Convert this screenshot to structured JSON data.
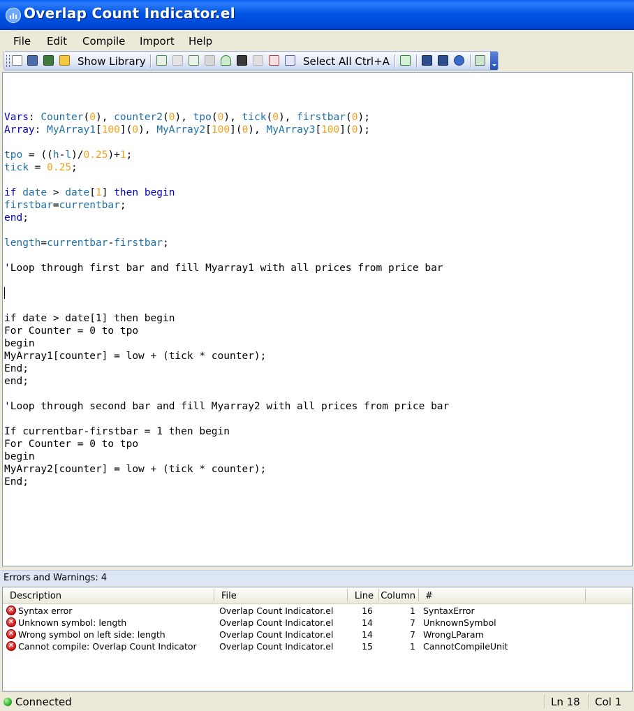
{
  "window": {
    "title": "Overlap Count Indicator.el"
  },
  "menu": {
    "items": [
      "File",
      "Edit",
      "Compile",
      "Import",
      "Help"
    ]
  },
  "toolbar": {
    "show_library_label": "Show Library",
    "select_all_label": "Select All Ctrl+A"
  },
  "editor": {
    "lines": [
      [
        [
          "Vars",
          1
        ],
        [
          ": ",
          0
        ],
        [
          "Counter",
          2
        ],
        [
          "(",
          0
        ],
        [
          "0",
          3
        ],
        [
          "), ",
          0
        ],
        [
          "counter2",
          2
        ],
        [
          "(",
          0
        ],
        [
          "0",
          3
        ],
        [
          "), ",
          0
        ],
        [
          "tpo",
          2
        ],
        [
          "(",
          0
        ],
        [
          "0",
          3
        ],
        [
          "), ",
          0
        ],
        [
          "tick",
          2
        ],
        [
          "(",
          0
        ],
        [
          "0",
          3
        ],
        [
          "), ",
          0
        ],
        [
          "firstbar",
          2
        ],
        [
          "(",
          0
        ],
        [
          "0",
          3
        ],
        [
          ");",
          0
        ]
      ],
      [
        [
          "Array",
          1
        ],
        [
          ": ",
          0
        ],
        [
          "MyArray1",
          2
        ],
        [
          "[",
          0
        ],
        [
          "100",
          3
        ],
        [
          "](",
          0
        ],
        [
          "0",
          3
        ],
        [
          "), ",
          0
        ],
        [
          "MyArray2",
          2
        ],
        [
          "[",
          0
        ],
        [
          "100",
          3
        ],
        [
          "](",
          0
        ],
        [
          "0",
          3
        ],
        [
          "), ",
          0
        ],
        [
          "MyArray3",
          2
        ],
        [
          "[",
          0
        ],
        [
          "100",
          3
        ],
        [
          "](",
          0
        ],
        [
          "0",
          3
        ],
        [
          ");",
          0
        ]
      ],
      [],
      [
        [
          "tpo",
          2
        ],
        [
          " = ((",
          0
        ],
        [
          "h",
          2
        ],
        [
          "-",
          0
        ],
        [
          "l",
          2
        ],
        [
          ")/",
          0
        ],
        [
          "0.25",
          3
        ],
        [
          ")+",
          0
        ],
        [
          "1",
          3
        ],
        [
          ";",
          0
        ]
      ],
      [
        [
          "tick",
          2
        ],
        [
          " = ",
          0
        ],
        [
          "0.25",
          3
        ],
        [
          ";",
          0
        ]
      ],
      [],
      [
        [
          "if",
          1
        ],
        [
          " ",
          0
        ],
        [
          "date",
          2
        ],
        [
          " > ",
          0
        ],
        [
          "date",
          2
        ],
        [
          "[",
          0
        ],
        [
          "1",
          3
        ],
        [
          "] ",
          0
        ],
        [
          "then",
          1
        ],
        [
          " ",
          0
        ],
        [
          "begin",
          1
        ]
      ],
      [
        [
          "firstbar",
          2
        ],
        [
          "=",
          0
        ],
        [
          "currentbar",
          2
        ],
        [
          ";",
          0
        ]
      ],
      [
        [
          "end",
          1
        ],
        [
          ";",
          0
        ]
      ],
      [],
      [
        [
          "length",
          2
        ],
        [
          "=",
          0
        ],
        [
          "currentbar",
          2
        ],
        [
          "-",
          0
        ],
        [
          "firstbar",
          2
        ],
        [
          ";",
          0
        ]
      ],
      [],
      [
        [
          "'Loop through first bar and fill Myarray1 with all prices from price bar",
          0
        ]
      ],
      [],
      [],
      [],
      [
        [
          "if date > date[1] then begin",
          0
        ]
      ],
      [
        [
          "For Counter = 0 to tpo",
          0
        ]
      ],
      [
        [
          "begin",
          0
        ]
      ],
      [
        [
          "MyArray1[counter] = low + (tick * counter);",
          0
        ]
      ],
      [
        [
          "End;",
          0
        ]
      ],
      [
        [
          "end;",
          0
        ]
      ],
      [],
      [
        [
          "'Loop through second bar and fill Myarray2 with all prices from price bar",
          0
        ]
      ],
      [],
      [
        [
          "If currentbar-firstbar = 1 then begin",
          0
        ]
      ],
      [
        [
          "For Counter = 0 to tpo",
          0
        ]
      ],
      [
        [
          "begin",
          0
        ]
      ],
      [
        [
          "MyArray2[counter] = low + (tick * counter);",
          0
        ]
      ],
      [
        [
          "End;",
          0
        ]
      ]
    ]
  },
  "errors": {
    "header": "Errors and Warnings: 4",
    "columns": {
      "description": "Description",
      "file": "File",
      "line": "Line",
      "column": "Column",
      "number": "#"
    },
    "rows": [
      {
        "description": "Syntax error",
        "file": "Overlap Count Indicator.el",
        "line": "16",
        "column": "1",
        "number": "SyntaxError"
      },
      {
        "description": "Unknown symbol: length",
        "file": "Overlap Count Indicator.el",
        "line": "14",
        "column": "7",
        "number": "UnknownSymbol"
      },
      {
        "description": "Wrong symbol on left side: length",
        "file": "Overlap Count Indicator.el",
        "line": "14",
        "column": "7",
        "number": "WrongLParam"
      },
      {
        "description": "Cannot compile: Overlap Count Indicator",
        "file": "Overlap Count Indicator.el",
        "line": "15",
        "column": "1",
        "number": "CannotCompileUnit"
      }
    ]
  },
  "status": {
    "connection": "Connected",
    "line": "Ln 18",
    "column": "Col 1"
  },
  "colors": {
    "keyword": "#0000C0",
    "variable": "#1F6FA8",
    "number": "#F2A01C",
    "titlebar": "#0054E3"
  }
}
